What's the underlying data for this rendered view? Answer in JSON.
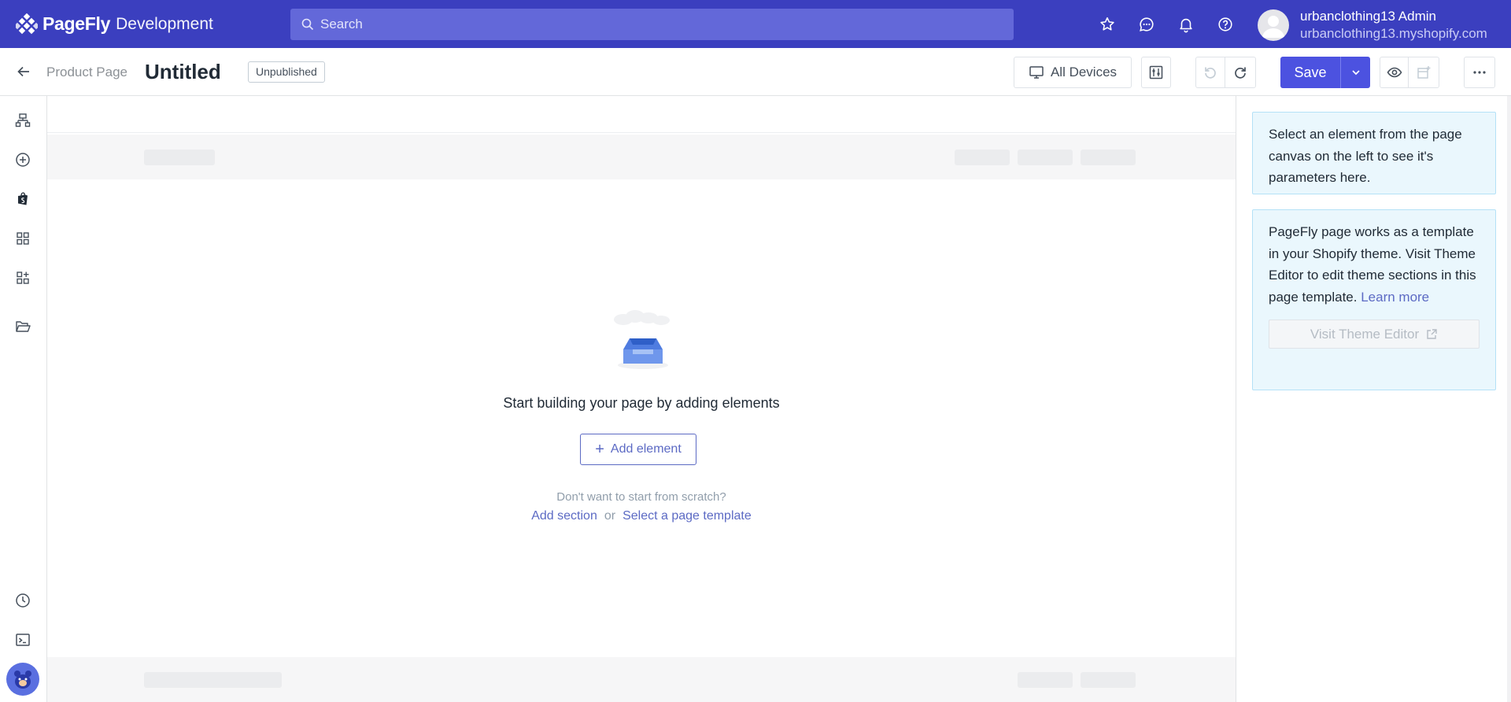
{
  "topbar": {
    "brand_name": "PageFly",
    "brand_sub": "Development",
    "search_placeholder": "Search",
    "user_name": "urbanclothing13 Admin",
    "user_shop": "urbanclothing13.myshopify.com"
  },
  "header": {
    "breadcrumb": "Product Page",
    "title": "Untitled",
    "status": "Unpublished",
    "devices_label": "All Devices",
    "save_label": "Save"
  },
  "canvas": {
    "empty_title": "Start building your page by adding elements",
    "add_element_label": "Add element",
    "scratch_text": "Don't want to start from scratch?",
    "add_section_label": "Add section",
    "or_text": "or",
    "select_template_label": "Select a page template"
  },
  "right_panel": {
    "select_hint": "Select an element from the page canvas on the left to see it's parameters here.",
    "template_info": "PageFly page works as a template in your Shopify theme. Visit Theme Editor to edit theme sections in this page template.",
    "learn_more": "Learn more",
    "visit_theme_editor": "Visit Theme Editor"
  },
  "colors": {
    "topbar_bg": "#3b3fbf",
    "primary": "#4c52e0",
    "link": "#5c6ac4",
    "info_bg": "#eaf7fd"
  },
  "icons": {
    "sidebar": [
      "layers-icon",
      "add-circle-icon",
      "shopify-bag-icon",
      "grid-icon",
      "grid-add-icon",
      "folder-open-icon",
      "clock-icon",
      "terminal-icon"
    ],
    "topbar": [
      "star-icon",
      "chat-icon",
      "bell-icon",
      "help-icon"
    ]
  }
}
